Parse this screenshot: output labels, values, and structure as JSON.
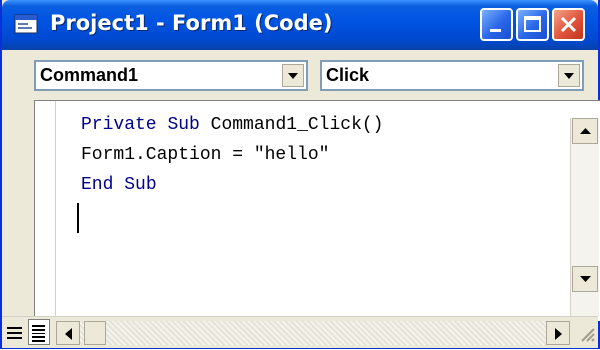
{
  "window": {
    "title": "Project1 - Form1 (Code)"
  },
  "combos": {
    "object_value": "Command1",
    "procedure_value": "Click"
  },
  "code": {
    "line1_kw1": "Private",
    "line1_kw2": "Sub",
    "line1_rest": "Command1_Click()",
    "line2": "Form1.Caption = \"hello\"",
    "line3_kw1": "End",
    "line3_kw2": "Sub"
  },
  "colors": {
    "titlebar": "#0054e3",
    "keyword": "#00008b",
    "close_button": "#e0533a"
  },
  "icons": [
    "form-icon",
    "minimize-icon",
    "maximize-icon",
    "close-icon",
    "chevron-down-icon",
    "arrow-up-icon",
    "arrow-down-icon",
    "arrow-left-icon",
    "arrow-right-icon",
    "procedure-view-icon",
    "full-module-view-icon",
    "resize-grip-icon"
  ]
}
